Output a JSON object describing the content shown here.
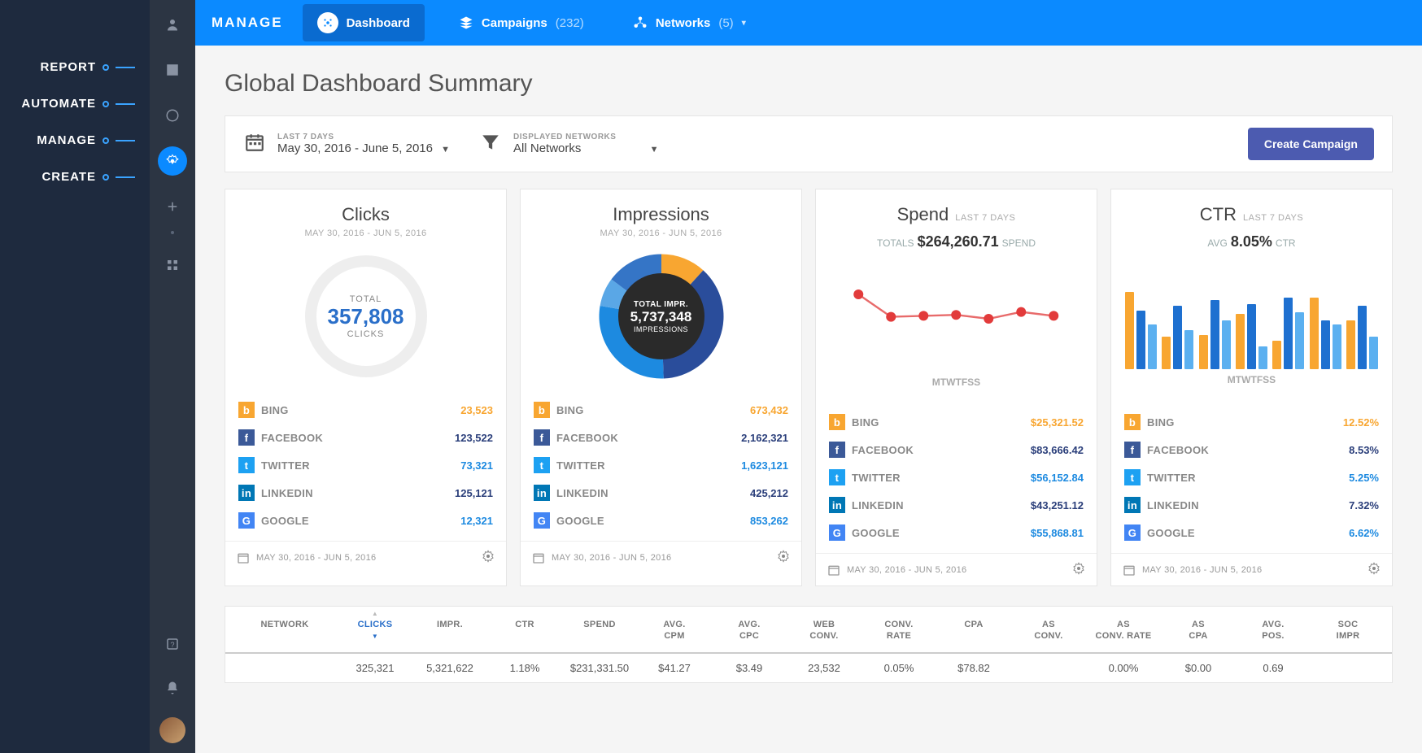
{
  "leftLabels": [
    "REPORT",
    "AUTOMATE",
    "MANAGE",
    "CREATE"
  ],
  "brand": "MANAGE",
  "topbar": {
    "dashboard": "Dashboard",
    "campaigns": {
      "label": "Campaigns",
      "count": "(232)"
    },
    "networks": {
      "label": "Networks",
      "count": "(5)"
    }
  },
  "pageTitle": "Global Dashboard Summary",
  "filters": {
    "date": {
      "label": "LAST 7 DAYS",
      "value": "May 30, 2016 - June 5, 2016"
    },
    "networks": {
      "label": "DISPLAYED NETWORKS",
      "value": "All Networks"
    },
    "createBtn": "Create Campaign"
  },
  "cardFooter": "MAY 30, 2016 - JUN 5, 2016",
  "days": [
    "M",
    "T",
    "W",
    "T",
    "F",
    "S",
    "S"
  ],
  "networksList": [
    {
      "k": "bing",
      "name": "BING",
      "icon": "b"
    },
    {
      "k": "fb",
      "name": "FACEBOOK",
      "icon": "f"
    },
    {
      "k": "tw",
      "name": "TWITTER",
      "icon": "t"
    },
    {
      "k": "li",
      "name": "LINKEDIN",
      "icon": "in"
    },
    {
      "k": "gg",
      "name": "GOOGLE",
      "icon": "G"
    }
  ],
  "cards": {
    "clicks": {
      "title": "Clicks",
      "sub": "MAY 30, 2016 - JUN 5, 2016",
      "centerLabel": "TOTAL",
      "centerValue": "357,808",
      "centerSub": "CLICKS",
      "rows": {
        "bing": "23,523",
        "fb": "123,522",
        "tw": "73,321",
        "li": "125,121",
        "gg": "12,321"
      }
    },
    "impr": {
      "title": "Impressions",
      "sub": "MAY 30, 2016 - JUN 5, 2016",
      "centerLabel": "TOTAL IMPR.",
      "centerValue": "5,737,348",
      "centerSub": "IMPRESSIONS",
      "rows": {
        "bing": "673,432",
        "fb": "2,162,321",
        "tw": "1,623,121",
        "li": "425,212",
        "gg": "853,262"
      }
    },
    "spend": {
      "title": "Spend",
      "tag": "LAST 7 DAYS",
      "summaryL": "TOTALS",
      "summaryV": "$264,260.71",
      "summaryR": "SPEND",
      "rows": {
        "bing": "$25,321.52",
        "fb": "$83,666.42",
        "tw": "$56,152.84",
        "li": "$43,251.12",
        "gg": "$55,868.81"
      }
    },
    "ctr": {
      "title": "CTR",
      "tag": "LAST 7 DAYS",
      "summaryL": "AVG",
      "summaryV": "8.05%",
      "summaryR": "CTR",
      "rows": {
        "bing": "12.52%",
        "fb": "8.53%",
        "tw": "5.25%",
        "li": "7.32%",
        "gg": "6.62%"
      }
    }
  },
  "chart_data": [
    {
      "type": "pie",
      "title": "Impressions",
      "series": [
        {
          "name": "BING",
          "value": 673432,
          "color": "#f8a631"
        },
        {
          "name": "FACEBOOK",
          "value": 2162321,
          "color": "#2a4d9b"
        },
        {
          "name": "TWITTER",
          "value": 1623121,
          "color": "#1d8ae0"
        },
        {
          "name": "LINKEDIN",
          "value": 425212,
          "color": "#5aa7e6"
        },
        {
          "name": "GOOGLE",
          "value": 853262,
          "color": "#3575c6"
        }
      ],
      "total": 5737348
    },
    {
      "type": "line",
      "title": "Spend",
      "categories": [
        "M",
        "T",
        "W",
        "T",
        "F",
        "S",
        "S"
      ],
      "values": [
        55,
        32,
        33,
        34,
        30,
        37,
        33
      ]
    },
    {
      "type": "bar",
      "title": "CTR",
      "categories": [
        "M",
        "T",
        "W",
        "T",
        "F",
        "S",
        "S"
      ],
      "series": [
        {
          "name": "orange",
          "values": [
            95,
            40,
            42,
            68,
            35,
            88,
            60
          ]
        },
        {
          "name": "blue",
          "values": [
            72,
            78,
            85,
            80,
            88,
            60,
            78
          ]
        },
        {
          "name": "lblue",
          "values": [
            55,
            48,
            60,
            28,
            70,
            55,
            40
          ]
        }
      ]
    }
  ],
  "table": {
    "headers": [
      "NETWORK",
      "CLICKS",
      "IMPR.",
      "CTR",
      "SPEND",
      "AVG. CPM",
      "AVG. CPC",
      "WEB CONV.",
      "CONV. RATE",
      "CPA",
      "AS CONV.",
      "AS CONV. RATE",
      "AS CPA",
      "AVG. POS.",
      "SOC IMPR"
    ],
    "sortIndex": 1,
    "row": [
      "",
      "325,321",
      "5,321,622",
      "1.18%",
      "$231,331.50",
      "$41.27",
      "$3.49",
      "23,532",
      "0.05%",
      "$78.82",
      "",
      "0.00%",
      "$0.00",
      "0.69",
      ""
    ]
  }
}
